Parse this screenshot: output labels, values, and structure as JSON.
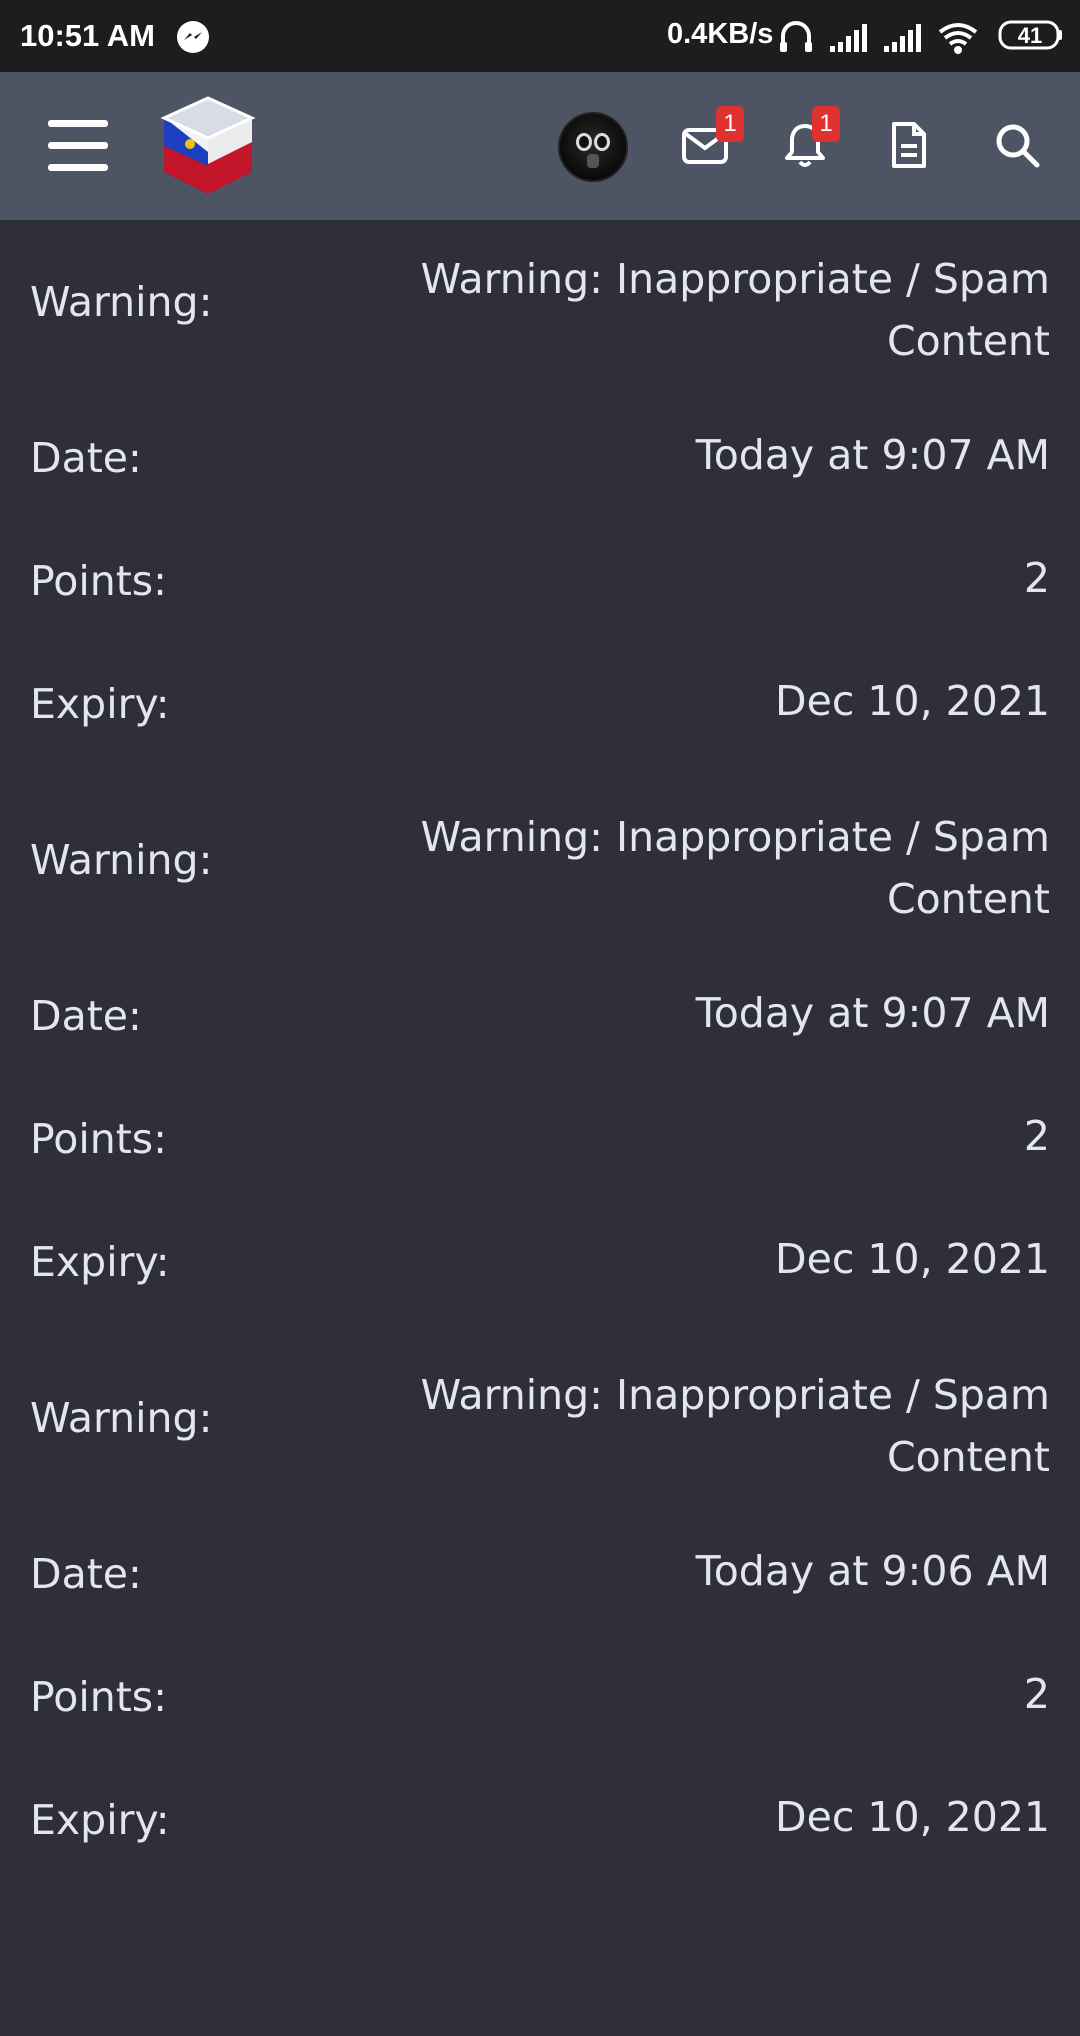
{
  "status_bar": {
    "time": "10:51 AM",
    "net_speed": "0.4KB/s",
    "battery": "41",
    "icons": [
      "messenger-icon",
      "headphones-icon",
      "signal-icon",
      "signal-icon",
      "wifi-icon",
      "battery-icon"
    ]
  },
  "header": {
    "icons": [
      "menu-icon",
      "site-logo",
      "avatar",
      "mail-icon",
      "bell-icon",
      "document-icon",
      "search-icon"
    ],
    "mail_badge": "1",
    "alerts_badge": "1"
  },
  "labels": {
    "warning": "Warning:",
    "date": "Date:",
    "points": "Points:",
    "expiry": "Expiry:"
  },
  "warnings": [
    {
      "warning": "Warning: Inappropriate / Spam Content",
      "date": "Today at 9:07 AM",
      "points": "2",
      "expiry": "Dec 10, 2021"
    },
    {
      "warning": "Warning: Inappropriate / Spam Content",
      "date": "Today at 9:07 AM",
      "points": "2",
      "expiry": "Dec 10, 2021"
    },
    {
      "warning": "Warning: Inappropriate / Spam Content",
      "date": "Today at 9:06 AM",
      "points": "2",
      "expiry": "Dec 10, 2021"
    }
  ],
  "colors": {
    "statusbar": "#1d1d20",
    "appbar": "#4d5565",
    "background": "#2f2f37",
    "text": "#e4e6ee",
    "badge": "#e03131"
  }
}
